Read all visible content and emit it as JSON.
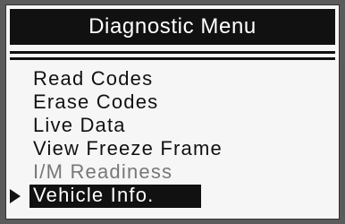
{
  "header": {
    "title": "Diagnostic Menu"
  },
  "menu": {
    "items": [
      {
        "label": "Read Codes",
        "state": "normal"
      },
      {
        "label": "Erase Codes",
        "state": "normal"
      },
      {
        "label": "Live Data",
        "state": "normal"
      },
      {
        "label": "View Freeze Frame",
        "state": "normal"
      },
      {
        "label": "I/M Readiness",
        "state": "dimmed"
      },
      {
        "label": "Vehicle Info.",
        "state": "selected"
      }
    ]
  },
  "icons": {
    "pointer": "triangle-right-icon"
  },
  "colors": {
    "screen_bg": "#f6f6f6",
    "frame": "#5b5b5b",
    "ink": "#111111",
    "dim": "#777777",
    "selected_text": "#ffffff"
  }
}
